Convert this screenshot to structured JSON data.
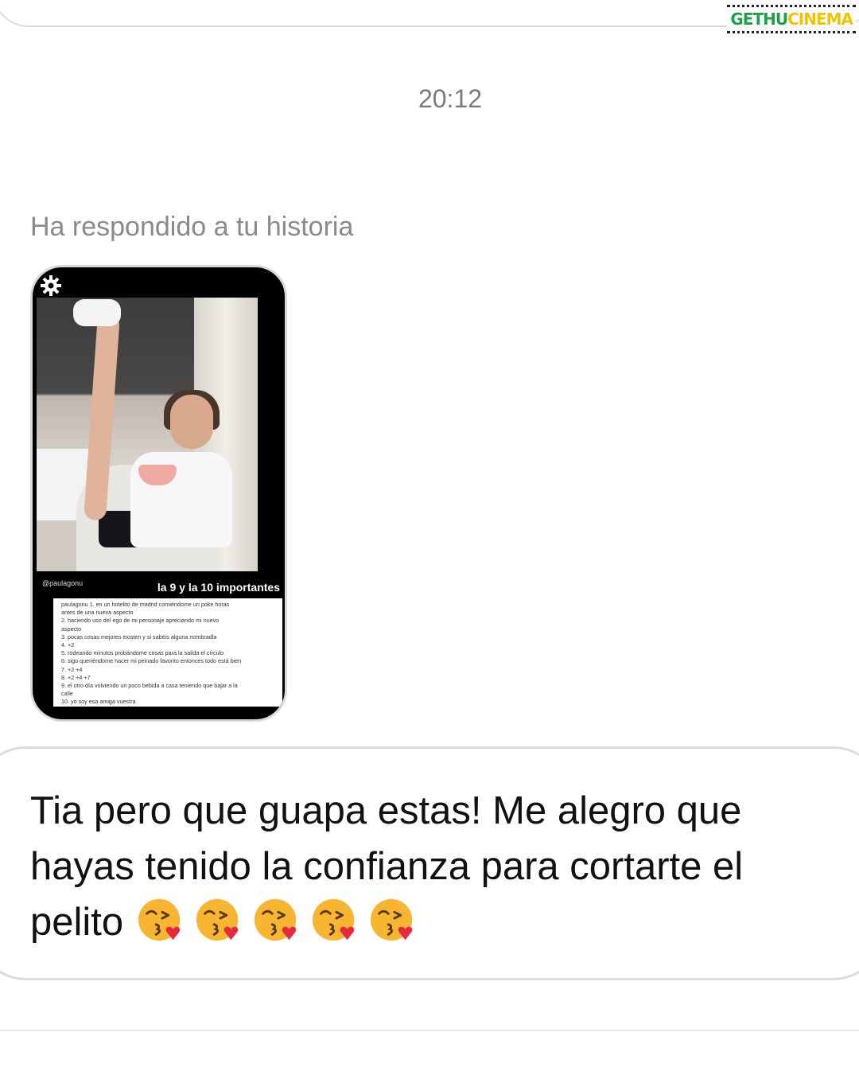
{
  "watermark": {
    "part1": "GETHU",
    "part2": "CINEMA"
  },
  "conversation": {
    "timestamp": "20:12",
    "reply_label": "Ha respondido a tu historia",
    "story": {
      "handle": "@paulagonu",
      "caption": "la 9 y la 10 importantes",
      "notes": [
        "paulagonu 1. en un hotelito de madrid comiéndome un poke horas",
        "antes de una nueva aspecto",
        "2. haciendo uso del ego de mi personaje apreciando mi nuevo",
        "aspecto",
        "3. pocas cosas mejores existen y si sabéis alguna nombradla",
        "4. +2",
        "5. rodeando minutos probándome cosas para la salida el círculo",
        "6. sigo queriéndome hacer mi peinado favorito entonces todo está bien",
        "7. +2 +4",
        "8. +2 +4 +7",
        "9. el otro día volviendo un poco bebida a casa teniendo que bajar a la",
        "calle",
        "10. yo soy esa amiga vuestra"
      ]
    },
    "message": {
      "text": "Tia pero que guapa estas!  Me alegro que hayas tenido la confianza para cortarte el pelito",
      "emoji": [
        "kissing-face-icon",
        "kissing-face-icon",
        "kissing-face-icon",
        "kissing-face-icon",
        "kissing-face-icon"
      ]
    }
  },
  "colors": {
    "bubble_border": "#dcdcdc",
    "timestamp": "#7a7a7a",
    "label": "#8a8a8a",
    "text": "#111111",
    "emoji_face": "#f7b531",
    "heart": "#e8283e"
  }
}
